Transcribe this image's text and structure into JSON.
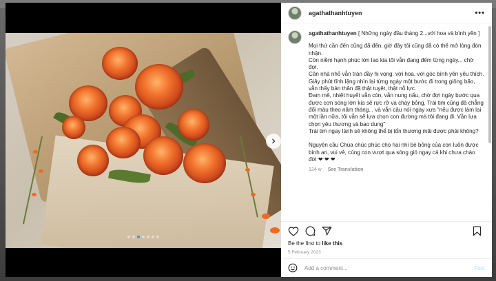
{
  "post": {
    "username": "agathathanhtuyen",
    "caption_title": "[ Những ngày đầu tháng 2...với hoa và bình yên ]",
    "caption_body": "Mọi thứ cần đến cũng đã đến, giờ đây tôi cũng đã có thể mở lòng đón nhận.\nCòn niềm hạnh phúc lớn lao kia tôi vẫn đang đếm từng ngày... chờ đợi.\nCăn nhà nhỏ vẫn tràn đầy hi vọng, với hoa, với góc bình yên yêu thích. Giây phút tĩnh lặng nhìn lại từng ngày một bước đi trong giông bão, vẫn thấy bản thân đã thật tuyệt, thật nỗ lực.\nĐam mê, nhiệt huyết vẫn còn, vẫn nung nấu, chờ đợi ngày bước qua được cơn sóng lớn kia sẽ rực rỡ và cháy bỏng. Trái tim cũng đã chẳng đổi màu theo năm tháng... và vẫn câu nói ngày xưa \"nếu được làm lại một lần nữa, tôi vẫn sẽ lựa chọn con đường mà tôi đang đi. Vẫn lựa chọn yêu thương và bao dung\"\nTrái tim ngay lành sẽ không thể bị tổn thương mãi được phải không?\n\nNguyện cầu Chúa chúc phúc cho hai nhi bé bỏng của con luôn được bình an, vui vẻ, cùng con vượt qua sóng gió ngay cả khi chưa chào đời ❤ ❤ ❤",
    "time_ago": "124 w",
    "see_translation": "See Translation",
    "likes_prefix": "Be the first to ",
    "likes_action": "like this",
    "date": "5 February 2023"
  },
  "comment": {
    "placeholder": "Add a comment...",
    "post_label": "Post"
  },
  "icons": {
    "more": "more-options-icon",
    "next": "chevron-right-icon",
    "like": "heart-icon",
    "comment": "comment-icon",
    "share": "share-icon",
    "save": "bookmark-icon",
    "emoji": "emoji-icon"
  },
  "carousel": {
    "count": 7,
    "active": 2
  },
  "colors": {
    "accent": "#3897f0",
    "post_disabled": "#b2dffc"
  }
}
